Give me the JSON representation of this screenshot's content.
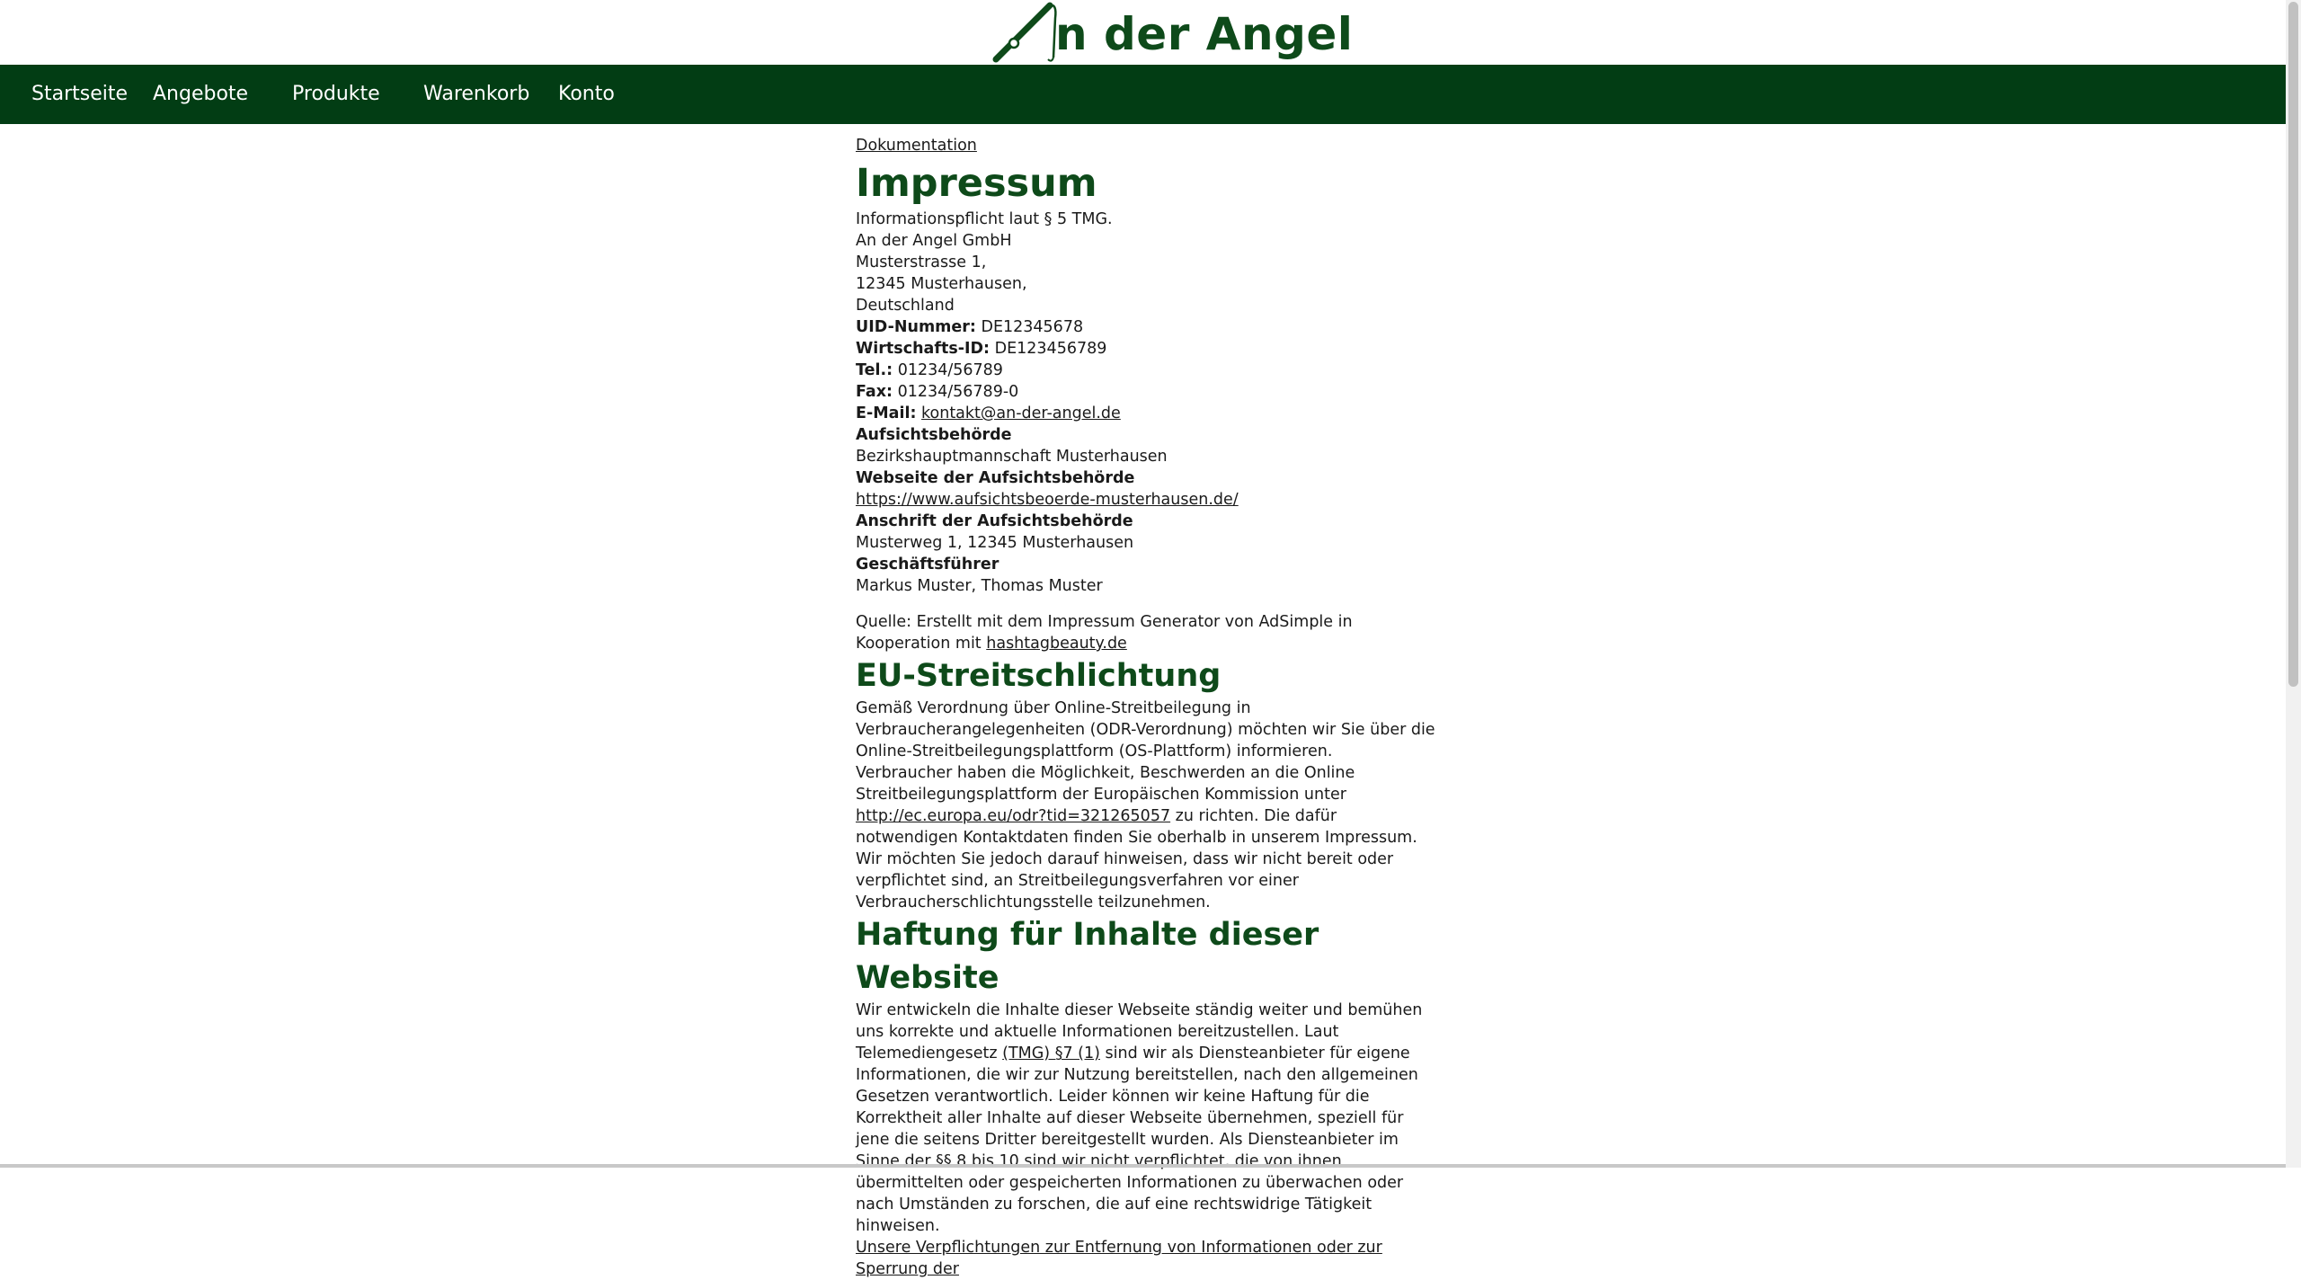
{
  "brand": {
    "name": "n der Angel",
    "color": "#0e4a1a"
  },
  "nav": {
    "background": "#023d14",
    "items": [
      "Startseite",
      "Angebote",
      "Produkte",
      "Warenkorb",
      "Konto"
    ]
  },
  "breadcrumb": "Dokumentation",
  "impressum": {
    "title": "Impressum",
    "intro": "Informationspflicht laut § 5 TMG.",
    "company": "An der Angel GmbH",
    "street": "Musterstrasse 1,",
    "city": "12345 Musterhausen,",
    "country": "Deutschland",
    "uid_label": "UID-Nummer:",
    "uid_value": " DE12345678",
    "wid_label": "Wirtschafts-ID:",
    "wid_value": " DE123456789",
    "tel_label": "Tel.:",
    "tel_value": " 01234/56789",
    "fax_label": "Fax:",
    "fax_value": " 01234/56789-0",
    "email_label": "E-Mail:",
    "email_value": "kontakt@an-der-angel.de",
    "authority_label": "Aufsichtsbehörde",
    "authority_value": "Bezirkshauptmannschaft Musterhausen",
    "authority_web_label": "Webseite der Aufsichtsbehörde",
    "authority_web_value": "https://www.aufsichtsbeoerde-musterhausen.de/",
    "authority_addr_label": "Anschrift der Aufsichtsbehörde",
    "authority_addr_value": "Musterweg 1, 12345 Musterhausen",
    "ceo_label": "Geschäftsführer",
    "ceo_value": "Markus Muster, Thomas Muster",
    "source_text": "Quelle: Erstellt mit dem Impressum Generator von AdSimple in Kooperation mit",
    "source_link": "hashtagbeauty.de"
  },
  "eu": {
    "title": "EU-Streitschlichtung",
    "p1": "Gemäß Verordnung über Online-Streitbeilegung in Verbraucherangelegenheiten (ODR-Verordnung) möchten wir Sie über die Online-Streitbeilegungsplattform (OS-Plattform) informieren.",
    "p2_before": "Verbraucher haben die Möglichkeit, Beschwerden an die Online Streitbeilegungsplattform der Europäischen Kommission unter ",
    "p2_link": "http://ec.europa.eu/odr?tid=321265057",
    "p2_after": " zu richten. Die dafür notwendigen Kontaktdaten finden Sie oberhalb in unserem Impressum.",
    "p3": "Wir möchten Sie jedoch darauf hinweisen, dass wir nicht bereit oder verpflichtet sind, an Streitbeilegungsverfahren vor einer Verbraucherschlichtungsstelle teilzunehmen."
  },
  "haftung": {
    "title": "Haftung für Inhalte dieser Website",
    "p1_before": "Wir entwickeln die Inhalte dieser Webseite ständig weiter und bemühen uns korrekte und aktuelle Informationen bereitzustellen. Laut Telemediengesetz ",
    "p1_link": "(TMG) §7 (1)",
    "p1_after": " sind wir als Diensteanbieter für eigene Informationen, die wir zur Nutzung bereitstellen, nach den allgemeinen Gesetzen verantwortlich. Leider können wir keine Haftung für die Korrektheit aller Inhalte auf dieser Webseite übernehmen, speziell für jene die seitens Dritter bereitgestellt wurden. Als Diensteanbieter im Sinne der §§ 8 bis 10 sind wir nicht verpflichtet, die von ihnen übermittelten oder gespeicherten Informationen zu überwachen oder nach Umständen zu forschen, die auf eine rechtswidrige Tätigkeit hinweisen.",
    "p2": "Unsere Verpflichtungen zur Entfernung von Informationen oder zur Sperrung der"
  }
}
